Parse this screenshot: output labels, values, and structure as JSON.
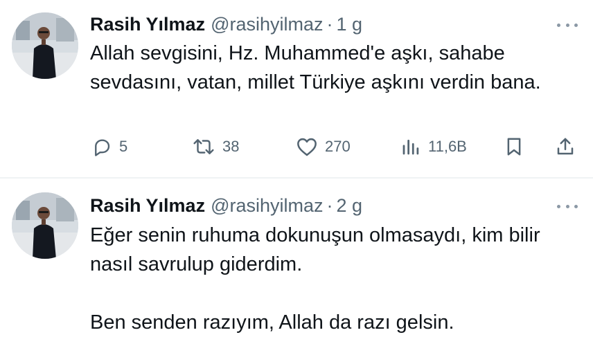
{
  "tweets": [
    {
      "author_name": "Rasih Yılmaz",
      "handle": "@rasihyilmaz",
      "separator": "·",
      "time": "1 g",
      "text": [
        "Allah sevgisini, Hz. Muhammed'e aşkı, sahabe sevdasını, vatan, millet Türkiye aşkını verdin bana."
      ],
      "replies": "5",
      "retweets": "38",
      "likes": "270",
      "views": "11,6B"
    },
    {
      "author_name": "Rasih Yılmaz",
      "handle": "@rasihyilmaz",
      "separator": "·",
      "time": "2 g",
      "text": [
        "Eğer senin ruhuma dokunuşun olmasaydı, kim bilir nasıl savrulup giderdim.",
        "Ben senden razıyım, Allah da razı gelsin."
      ]
    }
  ],
  "icons": {
    "reply": "reply-icon",
    "retweet": "retweet-icon",
    "like": "heart-icon",
    "views": "views-chart-icon",
    "bookmark": "bookmark-icon",
    "share": "share-icon",
    "more": "more-dots-icon"
  },
  "colors": {
    "text": "#0f1419",
    "secondary": "#536471",
    "divider": "#eff3f4"
  }
}
